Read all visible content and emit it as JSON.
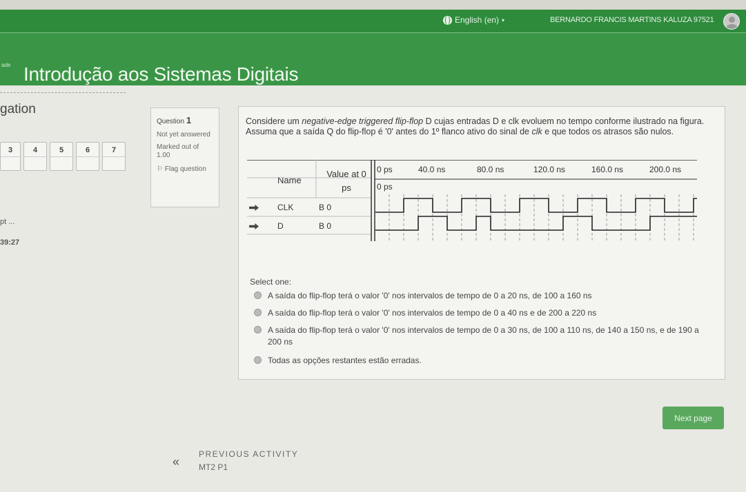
{
  "navbar": {
    "language": "English (en)",
    "user_name": "BERNARDO FRANCIS MARTINS KALUZA 97521"
  },
  "header": {
    "small_text": "ade",
    "course_title": "Introdução aos Sistemas Digitais"
  },
  "quiz_nav": {
    "title": "gation",
    "questions": [
      "3",
      "4",
      "5",
      "6",
      "7"
    ],
    "finish_attempt": "pt ...",
    "time_left": "39:27"
  },
  "question_info": {
    "question_label": "Question",
    "question_number": "1",
    "state": "Not yet answered",
    "grade": "Marked out of 1.00",
    "flag": "Flag question"
  },
  "question": {
    "text_part1": "Considere um ",
    "text_emphasis1": "negative-edge triggered flip-flop",
    "text_part2": " D cujas entradas D e clk evoluem no tempo conforme ilustrado na figura. Assuma que a saída Q do flip-flop é '0' antes do 1º flanco ativo do sinal de ",
    "text_emphasis2": "clk",
    "text_part3": " e que todos os atrasos são nulos."
  },
  "waveform": {
    "header_name": "Name",
    "header_value": "Value at 0 ps",
    "time_labels": [
      "0 ps",
      "40.0 ns",
      "80.0 ns",
      "120.0 ns",
      "160.0 ns",
      "200.0 ns"
    ],
    "cursor_label": "0 ps",
    "signals": [
      {
        "name": "CLK",
        "value": "B 0"
      },
      {
        "name": "D",
        "value": "B 0"
      }
    ]
  },
  "answer": {
    "select_label": "Select one:",
    "options": [
      "A saída do flip-flop terá o valor '0' nos intervalos de tempo de 0 a 20 ns, de 100 a 160 ns",
      "A saída do flip-flop terá o valor '0' nos intervalos de tempo de 0 a 40 ns e de 200 a 220 ns",
      "A saída do flip-flop terá o valor '0' nos intervalos de tempo de 0 a 30 ns, de 100 a 110 ns, de 140 a 150 ns, e de 190 a 200 ns",
      "Todas as opções restantes estão erradas."
    ]
  },
  "footer": {
    "next_button": "Next page",
    "previous_activity_label": "PREVIOUS ACTIVITY",
    "previous_activity_name": "MT2 P1"
  }
}
